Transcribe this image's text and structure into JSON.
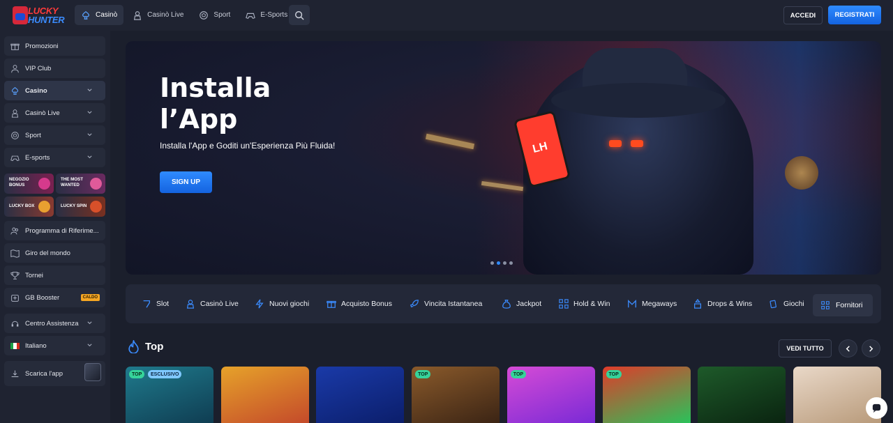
{
  "header": {
    "logo_top": "LUCKY",
    "logo_bottom": "HUNTER",
    "nav": [
      {
        "label": "Casinò",
        "icon": "club-icon",
        "active": true
      },
      {
        "label": "Casinò Live",
        "icon": "dealer-icon",
        "active": false
      },
      {
        "label": "Sport",
        "icon": "ball-icon",
        "active": false
      },
      {
        "label": "E-Sports",
        "icon": "gamepad-icon",
        "active": false
      }
    ],
    "login_label": "ACCEDI",
    "register_label": "REGISTRATI"
  },
  "sidebar": {
    "items": [
      {
        "label": "Promozioni",
        "icon": "gift-icon"
      },
      {
        "label": "VIP Club",
        "icon": "user-icon"
      },
      {
        "label": "Casino",
        "icon": "club-icon",
        "expandable": true,
        "active": true
      },
      {
        "label": "Casinò Live",
        "icon": "dealer-icon",
        "expandable": true
      },
      {
        "label": "Sport",
        "icon": "ball-icon",
        "expandable": true
      },
      {
        "label": "E-sports",
        "icon": "gamepad-icon",
        "expandable": true
      }
    ],
    "promos": [
      {
        "label_line1": "NEGOZIO",
        "label_line2": "BONUS"
      },
      {
        "label_line1": "THE MOST",
        "label_line2": "WANTED"
      },
      {
        "label_line1": "LUCKY BOX",
        "label_line2": ""
      },
      {
        "label_line1": "LUCKY SPIN",
        "label_line2": ""
      }
    ],
    "items2": [
      {
        "label": "Programma di Riferime...",
        "icon": "users-icon"
      },
      {
        "label": "Giro del mondo",
        "icon": "map-icon"
      },
      {
        "label": "Tornei",
        "icon": "trophy-icon"
      },
      {
        "label": "GB Booster",
        "icon": "booster-icon",
        "badge": "CALDO"
      }
    ],
    "support_label": "Centro Assistenza",
    "language_label": "Italiano",
    "app_label": "Scarica l'app"
  },
  "hero": {
    "title": "Installa l’App",
    "subtitle": "Installa l'App e Goditi un'Esperienza Più Fluida!",
    "button_label": "SIGN UP",
    "phone_logo": "LH",
    "slides_total": 4,
    "active_slide": 2
  },
  "categories": [
    {
      "label": "Slot",
      "icon": "slot-icon"
    },
    {
      "label": "Casinò Live",
      "icon": "dealer-icon"
    },
    {
      "label": "Nuovi giochi",
      "icon": "lightning-icon"
    },
    {
      "label": "Acquisto Bonus",
      "icon": "gift-icon"
    },
    {
      "label": "Vincita Istantanea",
      "icon": "rocket-icon"
    },
    {
      "label": "Jackpot",
      "icon": "moneybag-icon"
    },
    {
      "label": "Hold & Win",
      "icon": "grid-icon"
    },
    {
      "label": "Megaways",
      "icon": "megaways-icon"
    },
    {
      "label": "Drops & Wins",
      "icon": "drops-icon"
    },
    {
      "label": "Giochi",
      "icon": "cards-icon"
    }
  ],
  "providers_label": "Fornitori",
  "top_section": {
    "title": "Top",
    "see_all_label": "VEDI TUTTO",
    "games": [
      {
        "tags": [
          "TOP",
          "ESCLUSIVO"
        ],
        "colors": [
          "#1f7a8c",
          "#0f3d52"
        ]
      },
      {
        "tags": [],
        "colors": [
          "#e6a22a",
          "#c44a2a"
        ]
      },
      {
        "tags": [],
        "colors": [
          "#1a3aa8",
          "#0b1e6b"
        ]
      },
      {
        "tags": [
          "TOP"
        ],
        "colors": [
          "#8a5a2b",
          "#3b2414"
        ]
      },
      {
        "tags": [
          "TOP"
        ],
        "colors": [
          "#d64bd6",
          "#7a2ad6"
        ]
      },
      {
        "tags": [
          "TOP"
        ],
        "colors": [
          "#e03b2a",
          "#2ac25a"
        ]
      },
      {
        "tags": [],
        "colors": [
          "#1e5a2a",
          "#0a2410"
        ]
      },
      {
        "tags": [],
        "colors": [
          "#e9d8c8",
          "#b89a7a"
        ]
      }
    ]
  },
  "colors": {
    "accent": "#2f8bff",
    "background": "#1b1f2c",
    "panel": "#1f2331",
    "badge_top": "#36d39a",
    "badge_caldo": "#f5a623"
  }
}
